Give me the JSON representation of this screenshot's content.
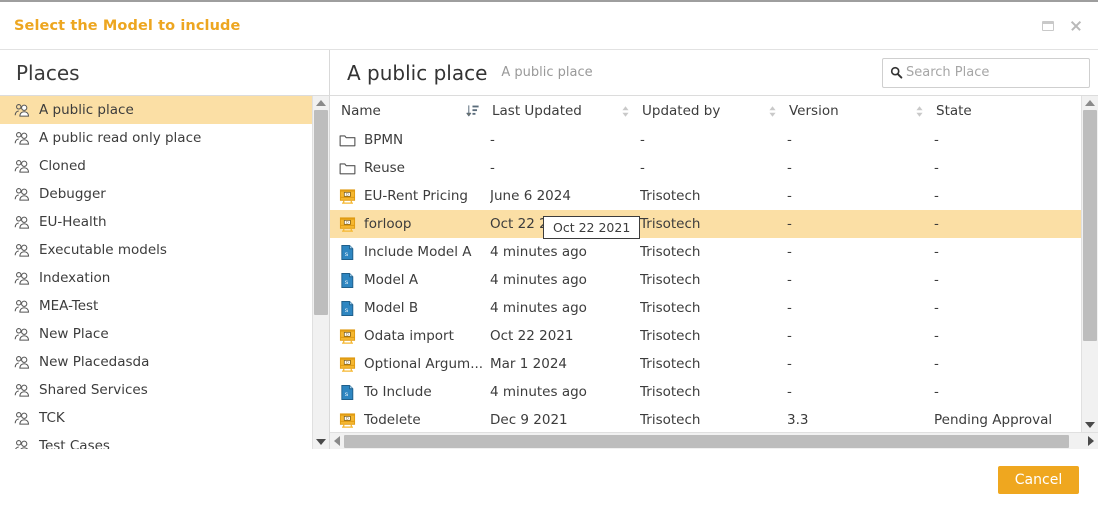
{
  "dialog": {
    "title": "Select the Model to include",
    "maximize_icon": "maximize-icon",
    "close_icon": "close-icon",
    "accent_color": "#eda620",
    "highlight_color": "#fbdfa5"
  },
  "sidebar": {
    "heading": "Places",
    "icon": "people-group-icon",
    "items": [
      {
        "label": "A public place",
        "selected": true
      },
      {
        "label": "A public read only place",
        "selected": false
      },
      {
        "label": "Cloned",
        "selected": false
      },
      {
        "label": "Debugger",
        "selected": false
      },
      {
        "label": "EU-Health",
        "selected": false
      },
      {
        "label": "Executable models",
        "selected": false
      },
      {
        "label": "Indexation",
        "selected": false
      },
      {
        "label": "MEA-Test",
        "selected": false
      },
      {
        "label": "New Place",
        "selected": false
      },
      {
        "label": "New Placedasda",
        "selected": false
      },
      {
        "label": "Shared Services",
        "selected": false
      },
      {
        "label": "TCK",
        "selected": false
      },
      {
        "label": "Test Cases",
        "selected": false
      }
    ]
  },
  "main": {
    "place_title": "A public place",
    "place_subtitle": "A public place",
    "search": {
      "placeholder": "Search Place",
      "value": "",
      "icon": "search-icon"
    }
  },
  "table": {
    "columns": [
      {
        "label": "Name",
        "sort": "descending",
        "sort_icon": "sort-descending-icon"
      },
      {
        "label": "Last Updated",
        "sort": "none",
        "sort_icon": "sort-updown-icon"
      },
      {
        "label": "Updated by",
        "sort": "none",
        "sort_icon": "sort-updown-icon"
      },
      {
        "label": "Version",
        "sort": "none",
        "sort_icon": "sort-updown-icon"
      },
      {
        "label": "State",
        "sort": "none",
        "sort_icon": "sort-updown-icon"
      }
    ],
    "rows": [
      {
        "icon": "folder-icon",
        "name": "BPMN",
        "last_updated": "-",
        "updated_by": "-",
        "version": "-",
        "state": "-",
        "selected": false
      },
      {
        "icon": "folder-icon",
        "name": "Reuse",
        "last_updated": "-",
        "updated_by": "-",
        "version": "-",
        "state": "-",
        "selected": false
      },
      {
        "icon": "dmn-icon",
        "name": "EU-Rent Pricing",
        "last_updated": "June 6 2024",
        "updated_by": "Trisotech",
        "version": "-",
        "state": "-",
        "selected": false
      },
      {
        "icon": "dmn-icon",
        "name": "forloop",
        "last_updated": "Oct 22 2021",
        "updated_by": "Trisotech",
        "version": "-",
        "state": "-",
        "selected": true
      },
      {
        "icon": "sdmn-icon",
        "name": "Include Model A",
        "last_updated": "4 minutes ago",
        "updated_by": "Trisotech",
        "version": "-",
        "state": "-",
        "selected": false
      },
      {
        "icon": "sdmn-icon",
        "name": "Model A",
        "last_updated": "4 minutes ago",
        "updated_by": "Trisotech",
        "version": "-",
        "state": "-",
        "selected": false
      },
      {
        "icon": "sdmn-icon",
        "name": "Model B",
        "last_updated": "4 minutes ago",
        "updated_by": "Trisotech",
        "version": "-",
        "state": "-",
        "selected": false
      },
      {
        "icon": "dmn-icon",
        "name": "Odata import",
        "last_updated": "Oct 22 2021",
        "updated_by": "Trisotech",
        "version": "-",
        "state": "-",
        "selected": false
      },
      {
        "icon": "dmn-icon",
        "name": "Optional Argum...",
        "last_updated": "Mar 1 2024",
        "updated_by": "Trisotech",
        "version": "-",
        "state": "-",
        "selected": false
      },
      {
        "icon": "sdmn-icon",
        "name": "To Include",
        "last_updated": "4 minutes ago",
        "updated_by": "Trisotech",
        "version": "-",
        "state": "-",
        "selected": false
      },
      {
        "icon": "dmn-icon",
        "name": "Todelete",
        "last_updated": "Dec 9 2021",
        "updated_by": "Trisotech",
        "version": "3.3",
        "state": "Pending Approval",
        "selected": false
      }
    ],
    "tooltip": {
      "text": "Oct 22 2021",
      "visible": true
    }
  },
  "footer": {
    "cancel_label": "Cancel"
  }
}
